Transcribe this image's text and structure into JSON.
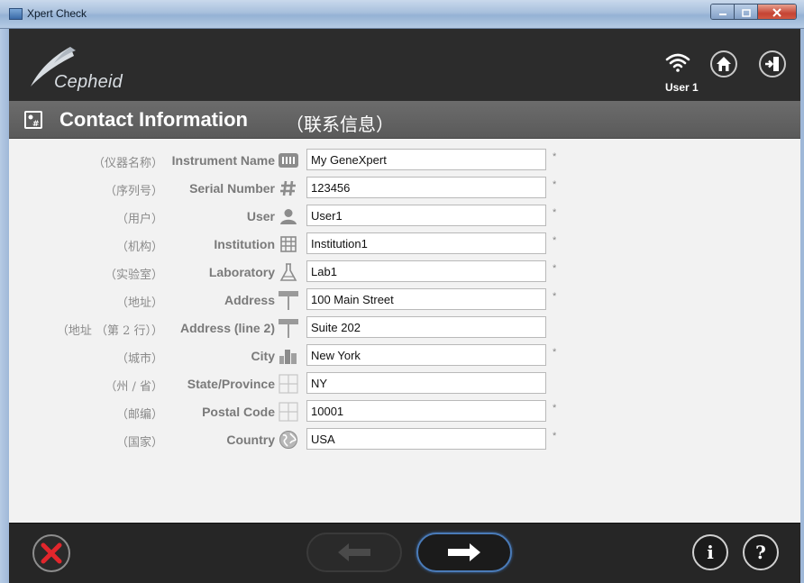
{
  "window": {
    "title": "Xpert Check"
  },
  "header": {
    "logo_text": "Cepheid",
    "user_label": "User 1",
    "icons": {
      "wifi": "wifi-icon",
      "home": "home-icon",
      "exit": "exit-icon"
    }
  },
  "section": {
    "title": "Contact Information",
    "title_cn": "（联系信息）",
    "icon": "contact-card-icon"
  },
  "form": {
    "rows": [
      {
        "label_cn": "（仪器名称）",
        "label": "Instrument Name",
        "icon": "instrument-icon",
        "value": "My GeneXpert",
        "required": "*"
      },
      {
        "label_cn": "（序列号）",
        "label": "Serial Number",
        "icon": "hash-icon",
        "value": "123456",
        "required": "*"
      },
      {
        "label_cn": "（用户）",
        "label": "User",
        "icon": "user-icon",
        "value": "User1",
        "required": "*"
      },
      {
        "label_cn": "（机构）",
        "label": "Institution",
        "icon": "building-icon",
        "value": "Institution1",
        "required": "*"
      },
      {
        "label_cn": "（实验室）",
        "label": "Laboratory",
        "icon": "flask-icon",
        "value": "Lab1",
        "required": "*"
      },
      {
        "label_cn": "（地址）",
        "label": "Address",
        "icon": "address-sign-icon",
        "value": "100 Main Street",
        "required": "*"
      },
      {
        "label_cn": "（地址 （第 2 行））",
        "label": "Address (line 2)",
        "icon": "address-sign-icon",
        "value": "Suite 202",
        "required": ""
      },
      {
        "label_cn": "（城市）",
        "label": "City",
        "icon": "city-icon",
        "value": "New York",
        "required": "*"
      },
      {
        "label_cn": "（州 / 省）",
        "label": "State/Province",
        "icon": "map-grid-icon",
        "value": "NY",
        "required": ""
      },
      {
        "label_cn": "（邮编）",
        "label": "Postal Code",
        "icon": "map-grid-icon",
        "value": "10001",
        "required": "*"
      },
      {
        "label_cn": "（国家）",
        "label": "Country",
        "icon": "globe-icon",
        "value": "USA",
        "required": "*"
      }
    ]
  },
  "footer": {
    "icons": {
      "cancel": "cancel-x-icon",
      "back": "arrow-left-icon",
      "next": "arrow-right-icon",
      "info": "info-icon",
      "help": "help-icon"
    },
    "info_glyph": "i",
    "help_glyph": "?",
    "back_enabled": false,
    "next_enabled": true
  },
  "colors": {
    "header_bg": "#2c2c2c",
    "section_bg": "#636363",
    "content_bg": "#f2f2f2",
    "footer_bg": "#262626",
    "cancel_red": "#e2262c",
    "next_border": "#4a7bb8"
  }
}
